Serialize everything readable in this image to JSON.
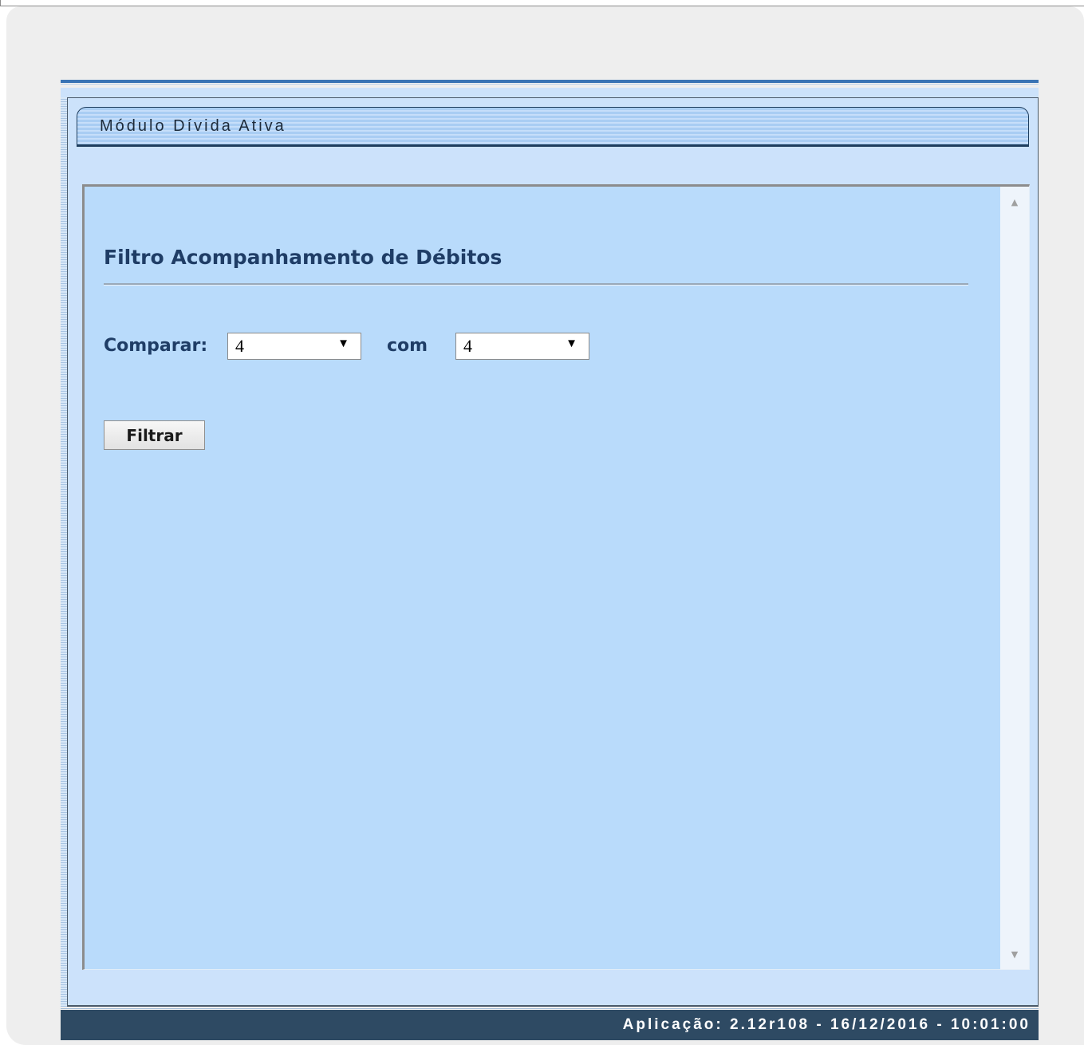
{
  "module": {
    "title": "Módulo Dívida Ativa"
  },
  "form": {
    "title": "Filtro Acompanhamento de Débitos",
    "compare_label": "Comparar:",
    "compare_value": "4",
    "with_label": "com",
    "with_value": "4",
    "filter_button": "Filtrar"
  },
  "footer": {
    "text": "Aplicação: 2.12r108 - 16/12/2016 - 10:01:00"
  },
  "icons": {
    "select_arrow": "▼",
    "scroll_up": "▲",
    "scroll_down": "▼"
  },
  "colors": {
    "header_bar": "#2e4a63",
    "content_background": "#b9dbfb",
    "heading_text": "#1f3d66"
  }
}
